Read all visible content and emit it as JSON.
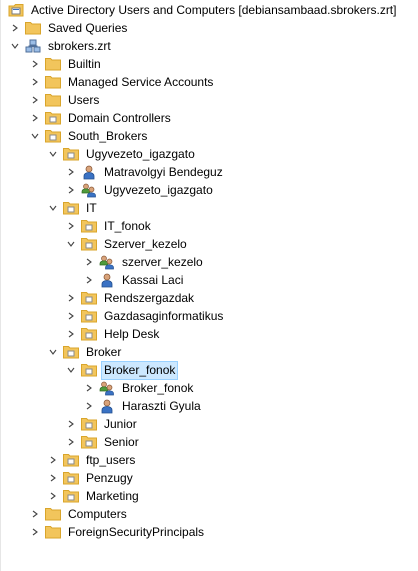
{
  "tree": {
    "root": {
      "label": "Active Directory Users and Computers [debiansambaad.sbrokers.zrt]"
    },
    "saved_queries": {
      "label": "Saved Queries"
    },
    "domain": {
      "label": "sbrokers.zrt"
    },
    "builtin": {
      "label": "Builtin"
    },
    "msa": {
      "label": "Managed Service Accounts"
    },
    "users": {
      "label": "Users"
    },
    "domain_controllers": {
      "label": "Domain Controllers"
    },
    "south_brokers": {
      "label": "South_Brokers"
    },
    "ugyvezeto_ou": {
      "label": "Ugyvezeto_igazgato"
    },
    "matravolgyi": {
      "label": "Matravolgyi Bendeguz"
    },
    "ugyvezeto_group": {
      "label": "Ugyvezeto_igazgato"
    },
    "it": {
      "label": "IT"
    },
    "it_fonok": {
      "label": "IT_fonok"
    },
    "szerver_kezelo_ou": {
      "label": "Szerver_kezelo"
    },
    "szerver_kezelo_group": {
      "label": "szerver_kezelo"
    },
    "kassai": {
      "label": "Kassai Laci"
    },
    "rendszergazdak": {
      "label": "Rendszergazdak"
    },
    "gazdasag": {
      "label": "Gazdasaginformatikus"
    },
    "helpdesk": {
      "label": "Help Desk"
    },
    "broker": {
      "label": "Broker"
    },
    "broker_fonok_ou": {
      "label": "Broker_fonok"
    },
    "broker_fonok_group": {
      "label": "Broker_fonok"
    },
    "haraszti": {
      "label": "Haraszti Gyula"
    },
    "junior": {
      "label": "Junior"
    },
    "senior": {
      "label": "Senior"
    },
    "ftp_users": {
      "label": "ftp_users"
    },
    "penzugy": {
      "label": "Penzugy"
    },
    "marketing": {
      "label": "Marketing"
    },
    "computers": {
      "label": "Computers"
    },
    "fsp": {
      "label": "ForeignSecurityPrincipals"
    }
  },
  "colors": {
    "folder": "#f2c55c",
    "folder_dark": "#d9a52b",
    "selection": "#cce8ff",
    "user_head": "#d9a37a",
    "user_body": "#3a72c4",
    "group_green": "#4f9a3b"
  }
}
